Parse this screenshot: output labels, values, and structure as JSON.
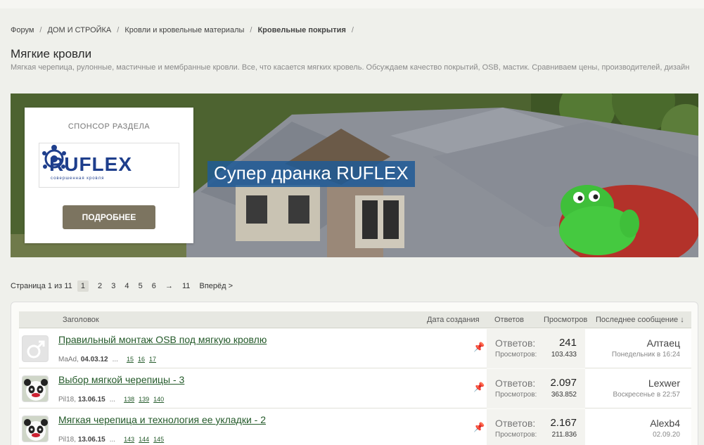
{
  "breadcrumb": {
    "items": [
      "Форум",
      "ДОМ И СТРОЙКА",
      "Кровли и кровельные материалы",
      "Кровельные покрытия"
    ],
    "separator": "/"
  },
  "forum": {
    "title": "Мягкие кровли",
    "description": "Мягкая черепица, рулонные, мастичные и мембранные кровли. Все, что касается мягких кровель. Обсуждаем качество покрытий, OSB, мастик. Сравниваем цены, производителей, дизайн"
  },
  "banner": {
    "sponsor_label": "СПОНСОР РАЗДЕЛА",
    "logo_text": "RUFLEX",
    "logo_subtext": "совершенная кровля",
    "more_button": "ПОДРОБНЕЕ",
    "headline": "Супер дранка RUFLEX"
  },
  "pager": {
    "summary": "Страница 1 из 11",
    "pages": [
      "1",
      "2",
      "3",
      "4",
      "5",
      "6",
      "→",
      "11"
    ],
    "current": "1",
    "next": "Вперёд >"
  },
  "table_header": {
    "title": "Заголовок",
    "created": "Дата создания",
    "replies": "Ответов",
    "views": "Просмотров",
    "last_post": "Последнее сообщение ↓"
  },
  "threads": [
    {
      "title": "Правильный монтаж OSB под мягкую кровлю",
      "author": "MaAd",
      "date": "04.03.12",
      "ellipsis": "...",
      "page_links": [
        "15",
        "16",
        "17"
      ],
      "replies_label": "Ответов:",
      "replies": "241",
      "views_label": "Просмотров:",
      "views": "103.433",
      "last_user": "Алтаец",
      "last_time": "Понедельник в 16:24",
      "avatar": "male-symbol",
      "pin_icon": "pin-icon"
    },
    {
      "title": "Выбор мягкой черепицы - 3",
      "author": "Pil18",
      "date": "13.06.15",
      "ellipsis": "...",
      "page_links": [
        "138",
        "139",
        "140"
      ],
      "replies_label": "Ответов:",
      "replies": "2.097",
      "views_label": "Просмотров:",
      "views": "363.852",
      "last_user": "Lexwer",
      "last_time": "Воскресенье в 22:57",
      "avatar": "panda",
      "pin_icon": "pin-icon"
    },
    {
      "title": "Мягкая черепица и технология ее укладки - 2",
      "author": "Pil18",
      "date": "13.06.15",
      "ellipsis": "...",
      "page_links": [
        "143",
        "144",
        "145"
      ],
      "replies_label": "Ответов:",
      "replies": "2.167",
      "views_label": "Просмотров:",
      "views": "211.836",
      "last_user": "Alexb4",
      "last_time": "02.09.20",
      "avatar": "panda",
      "pin_icon": "pin-icon"
    }
  ],
  "colors": {
    "link": "#245a2a",
    "button": "#7c7460",
    "headline_bg": "#1e5a96",
    "logo": "#1e3e8c"
  }
}
